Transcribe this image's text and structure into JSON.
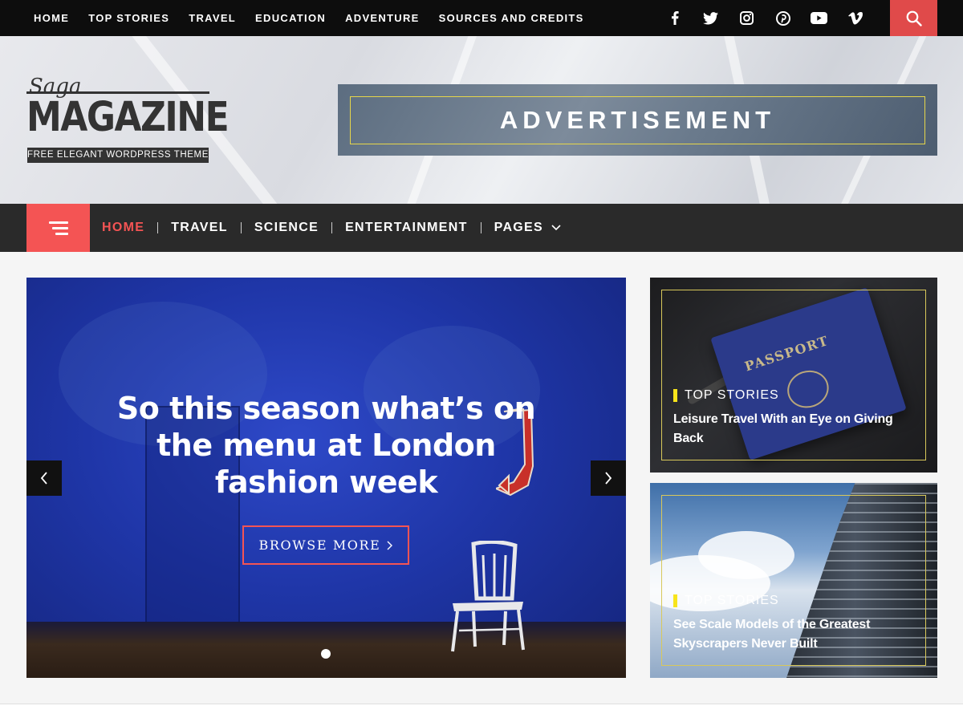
{
  "top_nav": {
    "items": [
      "HOME",
      "TOP STORIES",
      "TRAVEL",
      "EDUCATION",
      "ADVENTURE",
      "SOURCES AND CREDITS"
    ]
  },
  "social": {
    "icons": [
      "facebook-icon",
      "twitter-icon",
      "instagram-icon",
      "pinterest-icon",
      "youtube-icon",
      "vimeo-icon"
    ]
  },
  "search": {
    "icon": "search-icon",
    "color": "#e04a4a"
  },
  "logo": {
    "script": "Saga",
    "name": "MAGAZINE",
    "tagline": "FREE ELEGANT WORDPRESS THEME"
  },
  "ad": {
    "label": "ADVERTISEMENT"
  },
  "main_nav": {
    "menu_icon": "hamburger-icon",
    "items": [
      {
        "label": "HOME",
        "active": true
      },
      {
        "label": "TRAVEL",
        "active": false
      },
      {
        "label": "SCIENCE",
        "active": false
      },
      {
        "label": "ENTERTAINMENT",
        "active": false
      },
      {
        "label": "PAGES",
        "active": false,
        "dropdown": true
      }
    ],
    "accent": "#f45454"
  },
  "slider": {
    "title": "So this season what’s on the menu at London fashion week",
    "button": "BROWSE MORE",
    "slide_count": 1,
    "active_slide": 1
  },
  "side_cards": [
    {
      "category": "TOP STORIES",
      "title": "Leisure Travel With an Eye on Giving Back"
    },
    {
      "category": "TOP STORIES",
      "title": "See Scale Models of the Greatest Skyscrapers Never Built"
    }
  ],
  "colors": {
    "topbar": "#0d0d0d",
    "navbar": "#2a2a2a",
    "category_marker": "#f7e41b",
    "card_frame": "#d8c85a"
  }
}
